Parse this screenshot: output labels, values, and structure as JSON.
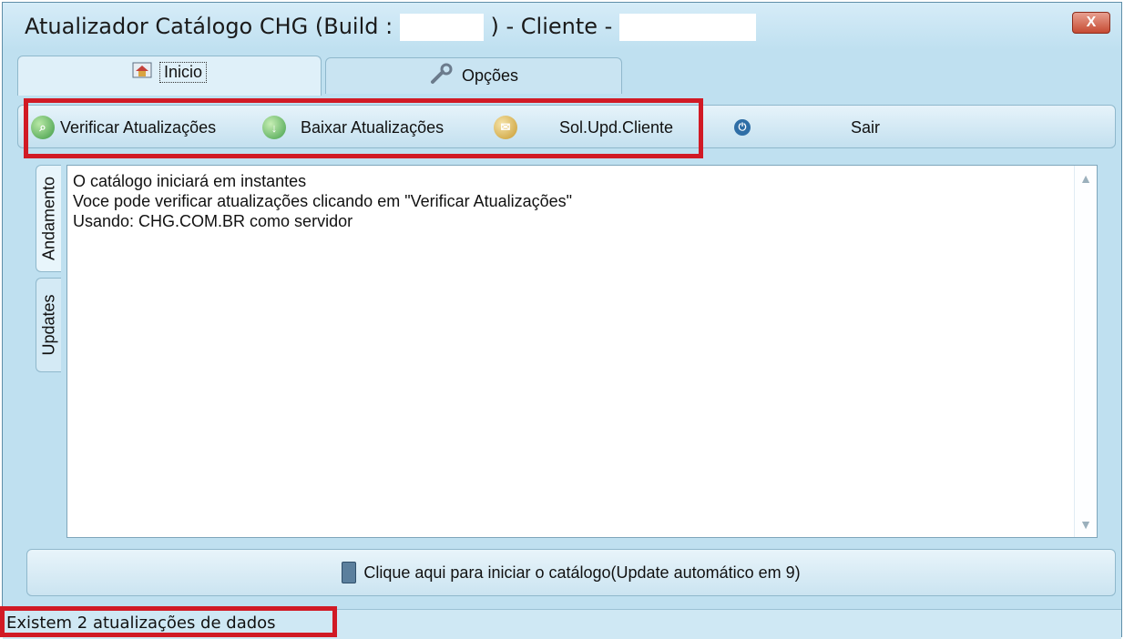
{
  "window": {
    "title_prefix": "Atualizador Catálogo CHG  (Build :",
    "title_middle": ") - Cliente -",
    "close_label": "X"
  },
  "tabs": [
    {
      "label": "Inicio",
      "icon": "house-icon",
      "active": true
    },
    {
      "label": "Opções",
      "icon": "wrench-icon",
      "active": false
    }
  ],
  "toolbar": {
    "items": [
      {
        "label": "Verificar Atualizações",
        "icon": "globe-search-icon"
      },
      {
        "label": "Baixar Atualizações",
        "icon": "globe-download-icon"
      },
      {
        "label": "Sol.Upd.Cliente",
        "icon": "client-request-icon"
      },
      {
        "label": "Sair",
        "icon": "power-icon"
      }
    ]
  },
  "side_tabs": [
    {
      "label": "Andamento",
      "active": true
    },
    {
      "label": "Updates",
      "active": false
    }
  ],
  "log": {
    "lines": [
      "O catálogo iniciará em instantes",
      "Voce pode verificar atualizações clicando em \"Verificar Atualizações\"",
      "Usando: CHG.COM.BR como servidor"
    ]
  },
  "start_bar": {
    "label": "Clique aqui para iniciar o catálogo(Update automático em 9)"
  },
  "status": {
    "text": "Existem 2 atualizações de dados"
  },
  "colors": {
    "window_bg": "#bfe0f0",
    "highlight": "#d11a25",
    "close_button": "#c64b33"
  }
}
